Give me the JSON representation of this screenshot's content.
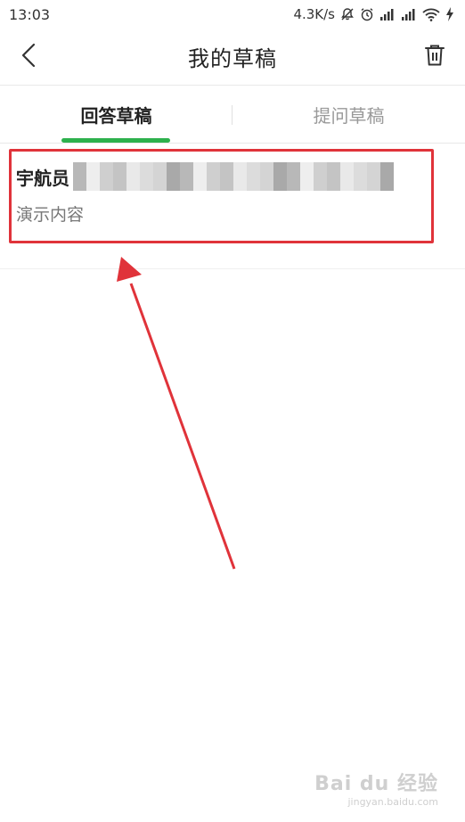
{
  "status_bar": {
    "time": "13:03",
    "speed": "4.3K/s",
    "icons": [
      "mute-bell-icon",
      "alarm-icon",
      "signal-icon",
      "signal-icon",
      "wifi-icon",
      "charging-icon"
    ]
  },
  "header": {
    "title": "我的草稿",
    "back_icon": "back-chevron-icon",
    "trash_icon": "trash-icon"
  },
  "tabs": [
    {
      "label": "回答草稿",
      "active": true
    },
    {
      "label": "提问草稿",
      "active": false
    }
  ],
  "drafts": [
    {
      "title": "宇航员",
      "title_redacted": true,
      "body": "演示内容"
    }
  ],
  "colors": {
    "accent_green": "#2db14d",
    "annotation_red": "#e0333a"
  },
  "watermark": {
    "brand": "Bai du 经验",
    "url": "jingyan.baidu.com"
  }
}
